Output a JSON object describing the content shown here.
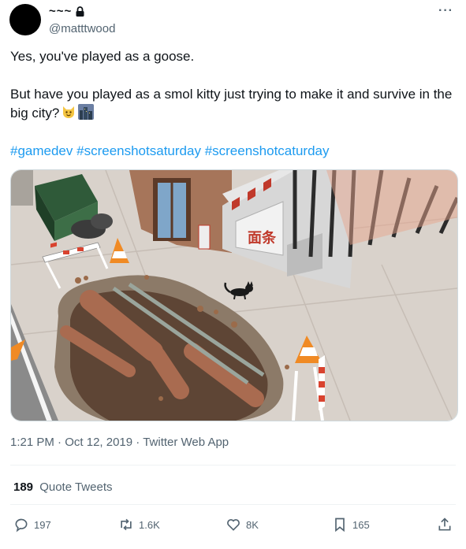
{
  "user": {
    "display_name": "~~~",
    "handle": "@matttwood"
  },
  "tweet": {
    "line1": "Yes, you've played as a goose.",
    "line2": "But have you played as a smol kitty just trying to make it and survive in the big city?",
    "emojis": [
      "cat-face-emoji",
      "cityscape-emoji"
    ],
    "hashtags": [
      "#gamedev",
      "#screenshotsaturday",
      "#screenshotcaturday"
    ]
  },
  "media": {
    "sign_text": "面条"
  },
  "meta": {
    "time": "1:21 PM",
    "date": "Oct 12, 2019",
    "source": "Twitter Web App",
    "separator": "·"
  },
  "stats": {
    "quote_count": "189",
    "quote_label": "Quote Tweets"
  },
  "actions": {
    "reply": "197",
    "retweet": "1.6K",
    "like": "8K",
    "bookmark": "165"
  },
  "colors": {
    "link": "#1d9bf0",
    "secondary": "#536471"
  }
}
